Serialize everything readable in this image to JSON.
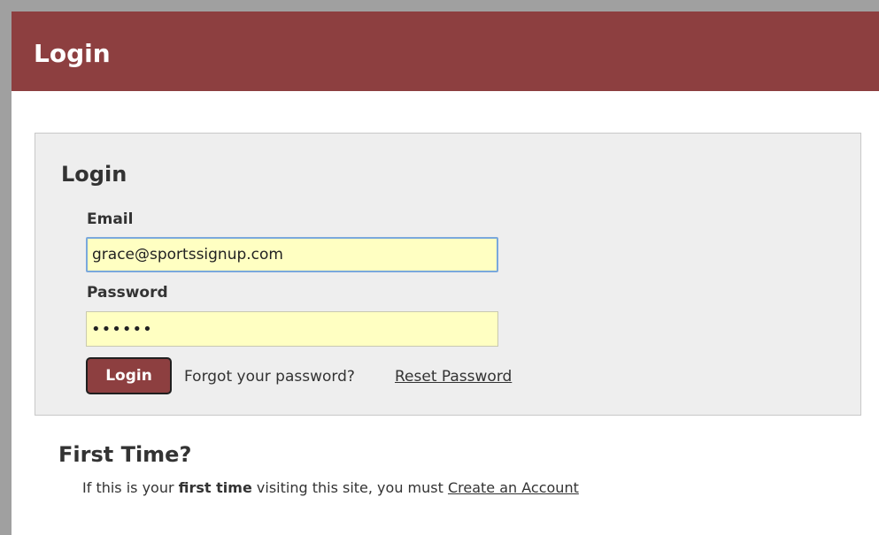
{
  "header": {
    "title": "Login"
  },
  "login_panel": {
    "title": "Login",
    "email_label": "Email",
    "email_value": "grace@sportssignup.com",
    "password_label": "Password",
    "password_value": "••••••",
    "login_button": "Login",
    "forgot_text": "Forgot your password?",
    "reset_link": "Reset Password"
  },
  "first_time": {
    "heading": "First Time?",
    "text_before": "If this is your",
    "text_bold": "first time",
    "text_after": "visiting this site, you must",
    "create_link": "Create an Account"
  },
  "colors": {
    "header_bg": "#8d3f40",
    "panel_bg": "#eeeeee",
    "input_bg": "#ffffc2",
    "focus_border": "#7aa8dc"
  }
}
